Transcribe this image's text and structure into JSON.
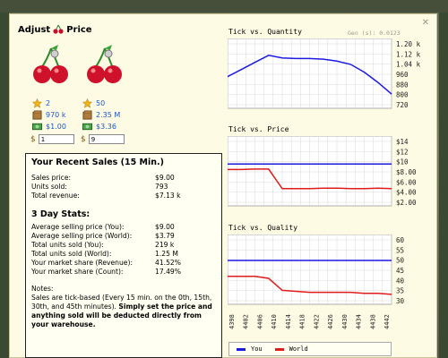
{
  "dialog": {
    "title_left": "Adjust",
    "title_right": "Price",
    "gen_label": "Gen (s): 0.0123"
  },
  "products": [
    {
      "icon": "cherry-icon",
      "quality": "2",
      "quantity": "970 k",
      "cost": "$1.00",
      "price_symbol": "$",
      "price_value": "1"
    },
    {
      "icon": "cherry-icon",
      "quality": "50",
      "quantity": "2.35 M",
      "cost": "$3.36",
      "price_symbol": "$",
      "price_value": "9"
    }
  ],
  "recent_sales": {
    "heading": "Your Recent Sales (15 Min.)",
    "rows": [
      {
        "label": "Sales price:",
        "value": "$9.00"
      },
      {
        "label": "Units sold:",
        "value": "793"
      },
      {
        "label": "Total revenue:",
        "value": "$7.13 k"
      }
    ]
  },
  "three_day": {
    "heading": "3 Day Stats:",
    "rows": [
      {
        "label": "Average selling price (You):",
        "value": "$9.00"
      },
      {
        "label": "Average selling price (World):",
        "value": "$3.79"
      },
      {
        "label": "Total units sold (You):",
        "value": "219 k"
      },
      {
        "label": "Total units sold (World):",
        "value": "1.25 M"
      },
      {
        "label": "Your market share (Revenue):",
        "value": "41.52%"
      },
      {
        "label": "Your market share (Count):",
        "value": "17.49%"
      }
    ]
  },
  "notes": {
    "label": "Notes:",
    "text": "Sales are tick-based (Every 15 min. on the 0th, 15th, 30th, and 45th minutes).",
    "bold": "Simply set the price and anything sold will be deducted directly from your warehouse."
  },
  "legend": {
    "you": "You",
    "world": "World"
  },
  "colors": {
    "you": "#1b1be0",
    "world": "#e01b1b",
    "bg": "#fdfbe3"
  },
  "chart_data": [
    {
      "type": "line",
      "title": "Tick vs. Quantity",
      "y_ticks": [
        "1.20 k",
        "1.12 k",
        "1.04 k",
        "960",
        "880",
        "800",
        "720"
      ],
      "ylim": [
        700,
        1240
      ],
      "x": [
        4398,
        4402,
        4406,
        4410,
        4414,
        4418,
        4422,
        4426,
        4430,
        4434,
        4438,
        4442,
        4446
      ],
      "series": [
        {
          "color": "#1b1be0",
          "values": [
            945,
            1000,
            1055,
            1110,
            1090,
            1085,
            1085,
            1080,
            1065,
            1040,
            980,
            900,
            810
          ]
        }
      ]
    },
    {
      "type": "line",
      "title": "Tick vs. Price",
      "y_ticks": [
        "$14",
        "$12",
        "$10",
        "$8.00",
        "$6.00",
        "$4.00",
        "$2.00"
      ],
      "ylim": [
        0,
        15
      ],
      "x": [
        4398,
        4402,
        4406,
        4410,
        4414,
        4418,
        4422,
        4426,
        4430,
        4434,
        4438,
        4442,
        4446
      ],
      "series": [
        {
          "name": "You",
          "color": "#1b1be0",
          "values": [
            9,
            9,
            9,
            9,
            9,
            9,
            9,
            9,
            9,
            9,
            9,
            9,
            9
          ]
        },
        {
          "name": "World",
          "color": "#e01b1b",
          "values": [
            7.8,
            7.8,
            7.9,
            7.9,
            3.7,
            3.7,
            3.7,
            3.8,
            3.8,
            3.7,
            3.7,
            3.8,
            3.7
          ]
        }
      ]
    },
    {
      "type": "line",
      "title": "Tick vs. Quality",
      "y_ticks": [
        "60",
        "55",
        "50",
        "45",
        "40",
        "35",
        "30"
      ],
      "ylim": [
        28,
        63
      ],
      "x": [
        4398,
        4402,
        4406,
        4410,
        4414,
        4418,
        4422,
        4426,
        4430,
        4434,
        4438,
        4442,
        4446
      ],
      "series": [
        {
          "name": "You",
          "color": "#1b1be0",
          "values": [
            50,
            50,
            50,
            50,
            50,
            50,
            50,
            50,
            50,
            50,
            50,
            50,
            50
          ]
        },
        {
          "name": "World",
          "color": "#e01b1b",
          "values": [
            42,
            42,
            42,
            41,
            35,
            34.5,
            34,
            34,
            34,
            34,
            33.5,
            33.5,
            33
          ]
        }
      ]
    }
  ],
  "x_tick_labels": [
    "4398",
    "4402",
    "4406",
    "4410",
    "4414",
    "4418",
    "4422",
    "4426",
    "4430",
    "4434",
    "4438",
    "4442"
  ]
}
